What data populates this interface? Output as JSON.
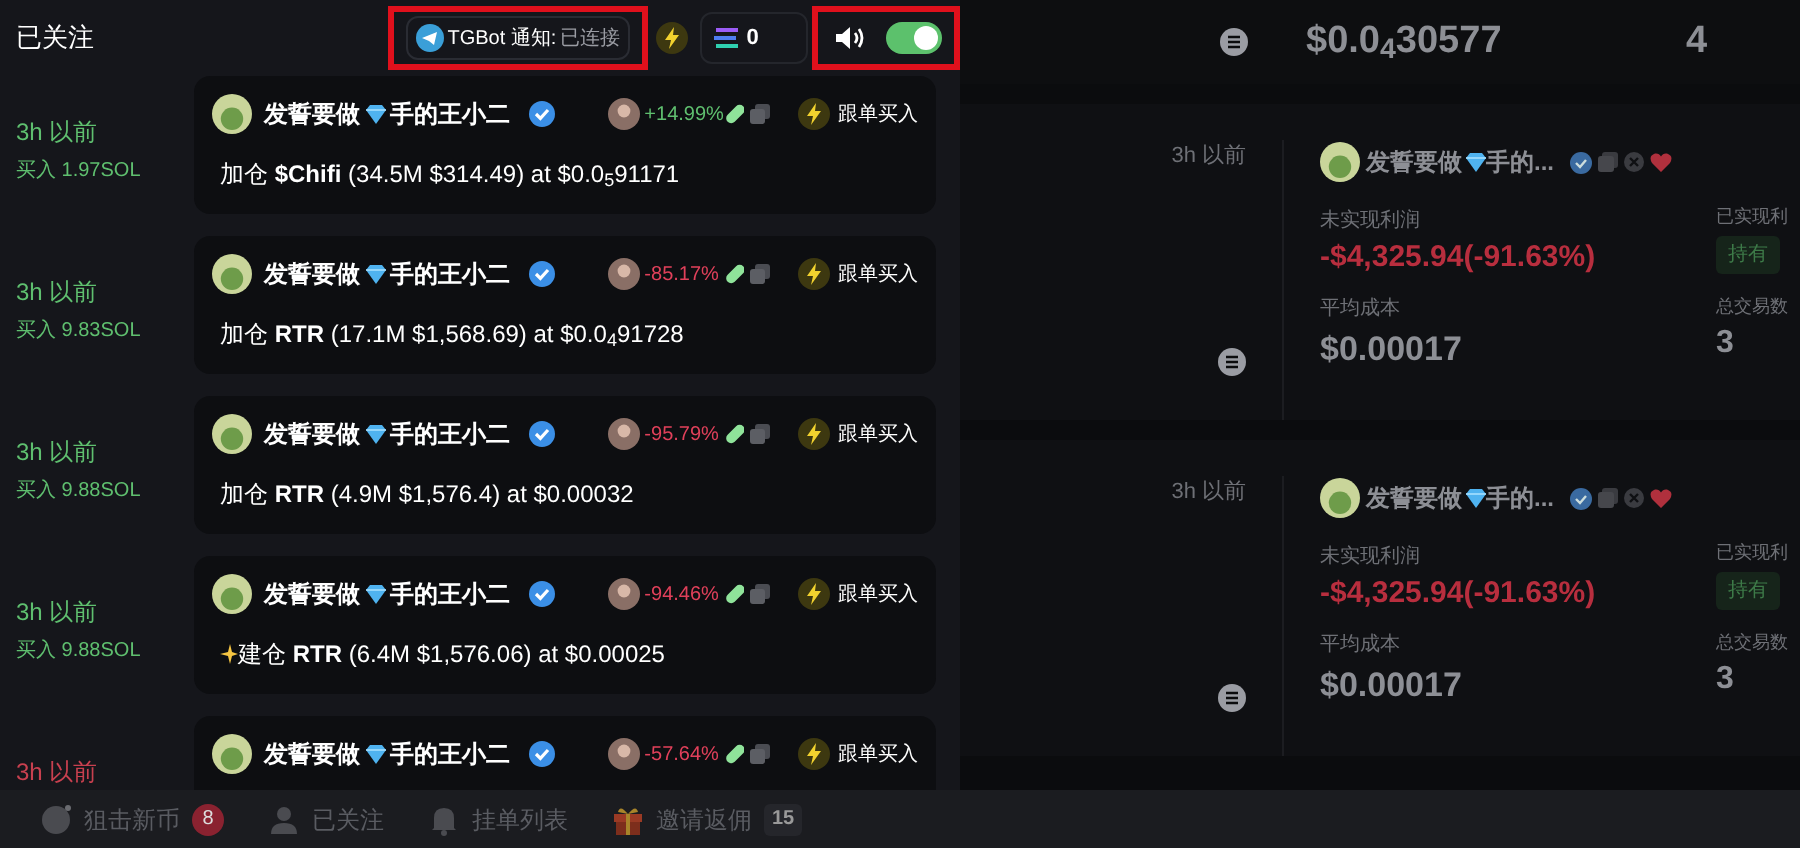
{
  "header": {
    "title": "已关注",
    "tgbot": {
      "label": "TGBot 通知:",
      "status": "已连接"
    },
    "sol_balance": "0",
    "sound": {
      "on": true
    }
  },
  "feed": [
    {
      "time": "3h 以前",
      "color": "#5fbf6f",
      "action": "买入 1.97SOL",
      "author": "发誓要做",
      "author_suffix": "手的王小二",
      "change": "+14.99%",
      "gain": true,
      "follow": "跟单买入",
      "message": "加仓 **$Chifi** (34.5M $314.49) at $0.0$_{5}$91171",
      "new_position": false
    },
    {
      "time": "3h 以前",
      "color": "#5fbf6f",
      "action": "买入 9.83SOL",
      "author": "发誓要做",
      "author_suffix": "手的王小二",
      "change": "-85.17%",
      "gain": false,
      "follow": "跟单买入",
      "message": "加仓 **RTR** (17.1M $1,568.69) at $0.0$_{4}$91728",
      "new_position": false
    },
    {
      "time": "3h 以前",
      "color": "#5fbf6f",
      "action": "买入 9.88SOL",
      "author": "发誓要做",
      "author_suffix": "手的王小二",
      "change": "-95.79%",
      "gain": false,
      "follow": "跟单买入",
      "message": "加仓 **RTR** (4.9M $1,576.4) at $0.00032",
      "new_position": false
    },
    {
      "time": "3h 以前",
      "color": "#5fbf6f",
      "action": "买入 9.88SOL",
      "author": "发誓要做",
      "author_suffix": "手的王小二",
      "change": "-94.46%",
      "gain": false,
      "follow": "跟单买入",
      "message": "建仓 **RTR** (6.4M $1,576.06) at $0.00025",
      "new_position": true
    },
    {
      "time": "3h 以前",
      "color": "#c8404f",
      "author": "发誓要做",
      "author_suffix": "手的王小二",
      "change": "-57.64%",
      "gain": false,
      "follow": "跟单买入"
    }
  ],
  "positions_top": {
    "price": "$0.0$_{4}$30577",
    "count": "4"
  },
  "positions": [
    {
      "time": "3h 以前",
      "author": "发誓要做",
      "author_suffix": "手的...",
      "unrealized_label": "未实现利润",
      "unrealized": "-$4,325.94(-91.63%)",
      "avg_cost_label": "平均成本",
      "avg_cost": "$0.00017",
      "realized_label": "已实现利",
      "status": "持有",
      "trades_label": "总交易数",
      "trades": "3"
    },
    {
      "time": "3h 以前",
      "author": "发誓要做",
      "author_suffix": "手的...",
      "unrealized_label": "未实现利润",
      "unrealized": "-$4,325.94(-91.63%)",
      "avg_cost_label": "平均成本",
      "avg_cost": "$0.00017",
      "realized_label": "已实现利",
      "status": "持有",
      "trades_label": "总交易数",
      "trades": "3"
    }
  ],
  "bottom_nav": [
    {
      "kind": "target",
      "label": "狙击新币",
      "badge": "8",
      "alert": true
    },
    {
      "kind": "user",
      "label": "已关注"
    },
    {
      "kind": "bell",
      "label": "挂单列表"
    },
    {
      "kind": "gift",
      "label": "邀请返佣",
      "badge": "15",
      "alert": false
    }
  ]
}
